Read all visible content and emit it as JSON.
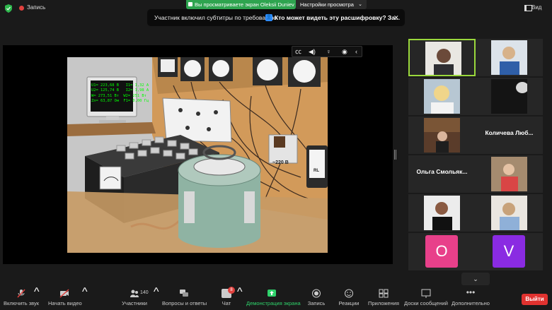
{
  "topbar": {
    "record_label": "Запись",
    "share_banner": "Вы просматриваете экран Oleksii Duniev",
    "view_options": "Настройки просмотра",
    "view_label": "Вид"
  },
  "toast": {
    "message": "Участник включил субтитры по требованию",
    "link": "Кто может видеть эту расшифровку? За...",
    "close": "✕"
  },
  "simulation": {
    "screen_lines": "U1= 223,68 В   I1= 1,32 А\nU2= 125,74 В   I2= 1,98 А\nW= 273,51 Вт  W2= 251 Вт\nZn= 63,87 Ом  F1= 0,00 Гц",
    "voltage_label": "~220 В",
    "rl_label": "RL"
  },
  "gallery": {
    "tiles": [
      {
        "type": "video"
      },
      {
        "type": "video"
      },
      {
        "type": "video"
      },
      {
        "type": "video"
      },
      {
        "type": "video"
      },
      {
        "type": "name",
        "name": "Количева Люб..."
      },
      {
        "type": "name",
        "name": "Ольга Смольяк..."
      },
      {
        "type": "video"
      },
      {
        "type": "video"
      },
      {
        "type": "video"
      },
      {
        "type": "letter",
        "letter": "O",
        "color": "#e8408a"
      },
      {
        "type": "letter",
        "letter": "V",
        "color": "#8a2be2"
      }
    ]
  },
  "toolbar": {
    "mute": "Включить звук",
    "video": "Начать видео",
    "participants": "Участники",
    "participants_count": "140",
    "qa": "Вопросы и ответы",
    "chat": "Чат",
    "chat_badge": "8",
    "share": "Демонстрация экрана",
    "record": "Запись",
    "reactions": "Реакции",
    "apps": "Приложения",
    "whiteboards": "Доски сообщений",
    "more": "Дополнительно",
    "leave": "Выйти"
  }
}
